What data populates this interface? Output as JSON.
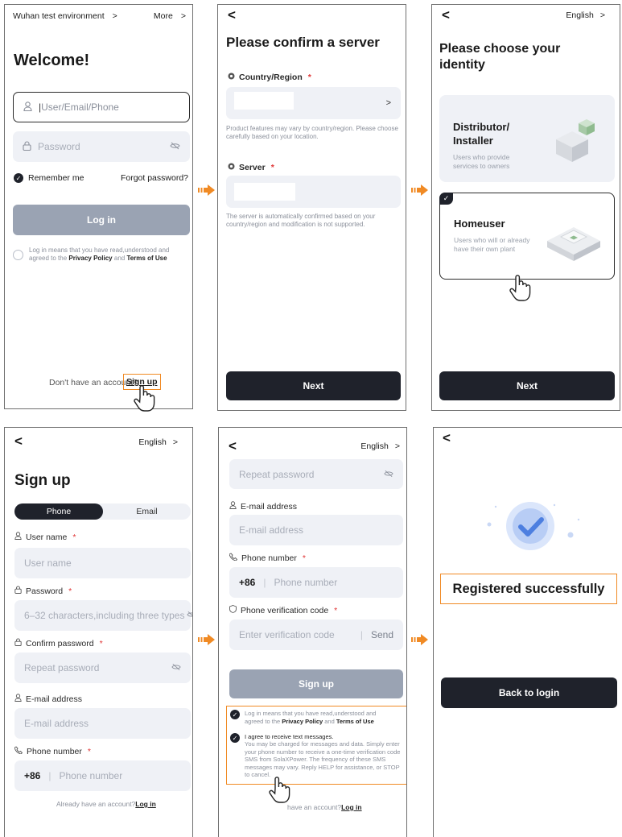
{
  "arrow_color": "#f08a24",
  "panel1": {
    "env_label": "Wuhan test environment",
    "env_chevron": ">",
    "more_label": "More",
    "more_chevron": ">",
    "welcome": "Welcome!",
    "user_placeholder": "User/Email/Phone",
    "password_placeholder": "Password",
    "remember_me": "Remember me",
    "forgot_password": "Forgot password?",
    "login_button": "Log in",
    "agree_text_1": "Log in means that you have read,understood and",
    "agree_text_2": "agreed to the ",
    "privacy_policy": "Privacy Policy",
    "and": " and ",
    "terms": "Terms of Use",
    "no_account": "Don't have an account?",
    "sign_up_link": "Sign up"
  },
  "panel2": {
    "back": "<",
    "title": "Please confirm a server",
    "country_label": "Country/Region",
    "required": "*",
    "country_chevron": ">",
    "country_note": "Product features may vary by country/region. Please choose carefully based on your location.",
    "server_label": "Server",
    "server_note": "The server is automatically confirmed based on your country/region and modification is not supported.",
    "next_button": "Next"
  },
  "panel3": {
    "back": "<",
    "language": "English",
    "language_chevron": ">",
    "title_line1": "Please choose your",
    "title_line2": "identity",
    "distributor_title_1": "Distributor/",
    "distributor_title_2": "Installer",
    "distributor_desc_1": "Users who provide",
    "distributor_desc_2": "services to owners",
    "homeuser_title": "Homeuser",
    "homeuser_desc_1": "Users who will or already",
    "homeuser_desc_2": "have their own plant",
    "check_mark": "✓",
    "next_button": "Next"
  },
  "panel4": {
    "back": "<",
    "language": "English",
    "language_chevron": ">",
    "title": "Sign up",
    "tab_phone": "Phone",
    "tab_email": "Email",
    "username_label": "User name",
    "username_placeholder": "User name",
    "password_label": "Password",
    "password_placeholder": "6–32 characters,including three types",
    "confirm_label": "Confirm password",
    "confirm_placeholder": "Repeat password",
    "email_label": "E-mail address",
    "email_placeholder": "E-mail address",
    "phone_label": "Phone number",
    "country_code": "+86",
    "phone_placeholder": "Phone number",
    "required": "*",
    "have_account": "Already have an account?",
    "login_link": "Log in"
  },
  "panel5": {
    "back": "<",
    "language": "English",
    "language_chevron": ">",
    "repeat_placeholder": "Repeat password",
    "email_label": "E-mail address",
    "email_placeholder": "E-mail address",
    "phone_label": "Phone number",
    "country_code": "+86",
    "phone_placeholder": "Phone number",
    "verify_label": "Phone verification code",
    "verify_placeholder": "Enter verification code",
    "send": "Send",
    "required": "*",
    "signup_button": "Sign up",
    "agree_1": "Log in means that you have read,understood and",
    "agree_2a": "agreed to the ",
    "privacy_policy": "Privacy Policy",
    "and": " and ",
    "terms": "Terms of Use",
    "sms_title": "I agree to receive text messages.",
    "sms_body": "You may be charged for messages and data. Simply enter your phone number to receive a one-time verification code SMS from SolaXPower. The frequency of these SMS messages may vary. Reply HELP for assistance, or STOP to cancel.",
    "have_account": "have an account?",
    "login_link": "Log in"
  },
  "panel6": {
    "back": "<",
    "success_text": "Registered successfully",
    "back_to_login": "Back to login"
  }
}
